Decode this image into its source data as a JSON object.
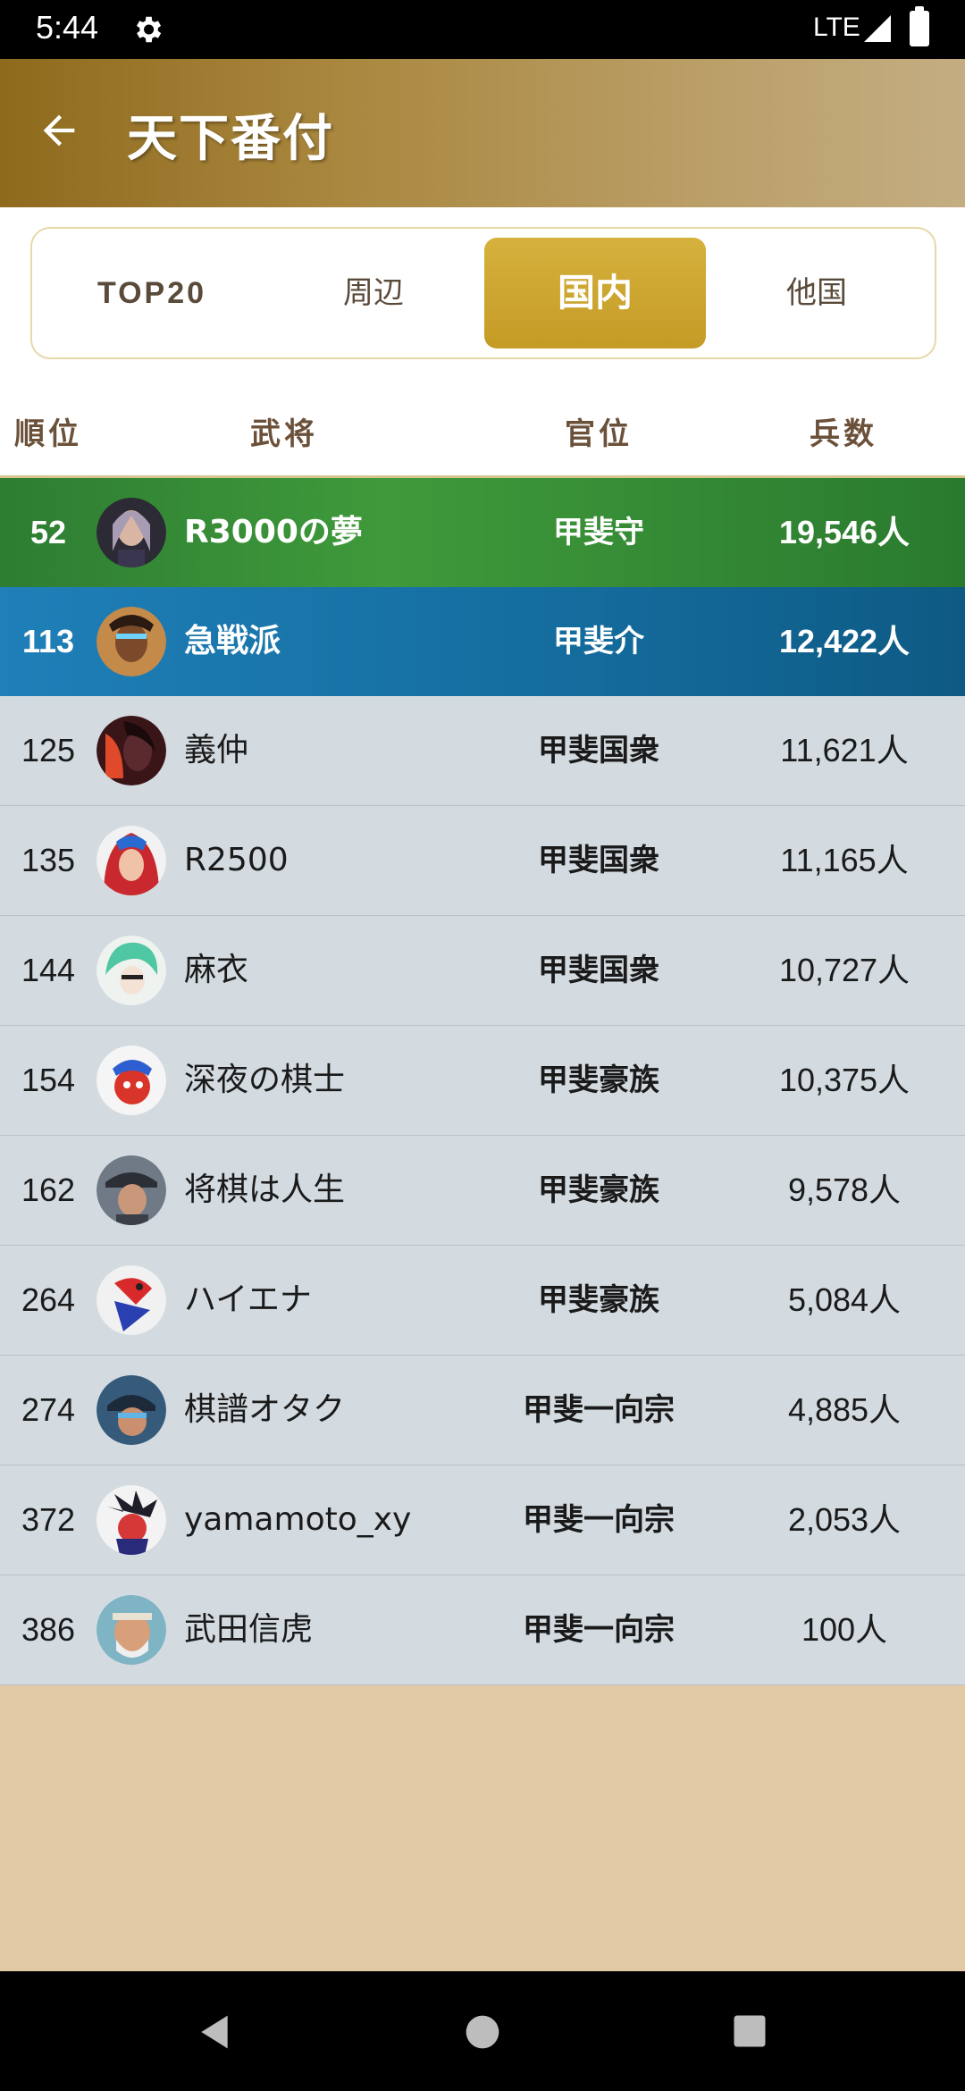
{
  "status_bar": {
    "time": "5:44",
    "network": "LTE"
  },
  "app_bar": {
    "title": "天下番付"
  },
  "tabs": [
    {
      "label": "TOP20",
      "active": false
    },
    {
      "label": "周辺",
      "active": false
    },
    {
      "label": "国内",
      "active": true
    },
    {
      "label": "他国",
      "active": false
    }
  ],
  "table": {
    "headers": {
      "rank": "順位",
      "general": "武将",
      "title": "官位",
      "troops": "兵数"
    },
    "rows": [
      {
        "rank": "52",
        "name": "R3000の夢",
        "title": "甲斐守",
        "troops": "19,546人",
        "highlight": "green"
      },
      {
        "rank": "113",
        "name": "急戦派",
        "title": "甲斐介",
        "troops": "12,422人",
        "highlight": "blue"
      },
      {
        "rank": "125",
        "name": "義仲",
        "title": "甲斐国衆",
        "troops": "11,621人"
      },
      {
        "rank": "135",
        "name": "R2500",
        "title": "甲斐国衆",
        "troops": "11,165人"
      },
      {
        "rank": "144",
        "name": "麻衣",
        "title": "甲斐国衆",
        "troops": "10,727人"
      },
      {
        "rank": "154",
        "name": "深夜の棋士",
        "title": "甲斐豪族",
        "troops": "10,375人"
      },
      {
        "rank": "162",
        "name": "将棋は人生",
        "title": "甲斐豪族",
        "troops": "9,578人"
      },
      {
        "rank": "264",
        "name": "ハイエナ",
        "title": "甲斐豪族",
        "troops": "5,084人"
      },
      {
        "rank": "274",
        "name": "棋譜オタク",
        "title": "甲斐一向宗",
        "troops": "4,885人"
      },
      {
        "rank": "372",
        "name": "yamamoto_xy",
        "title": "甲斐一向宗",
        "troops": "2,053人"
      },
      {
        "rank": "386",
        "name": "武田信虎",
        "title": "甲斐一向宗",
        "troops": "100人"
      }
    ]
  },
  "colors": {
    "accent_gold": "#c9a22d",
    "row_self_green": "#2e7d32",
    "row_rival_blue": "#1577ad",
    "row_default": "#d3dbe0"
  }
}
